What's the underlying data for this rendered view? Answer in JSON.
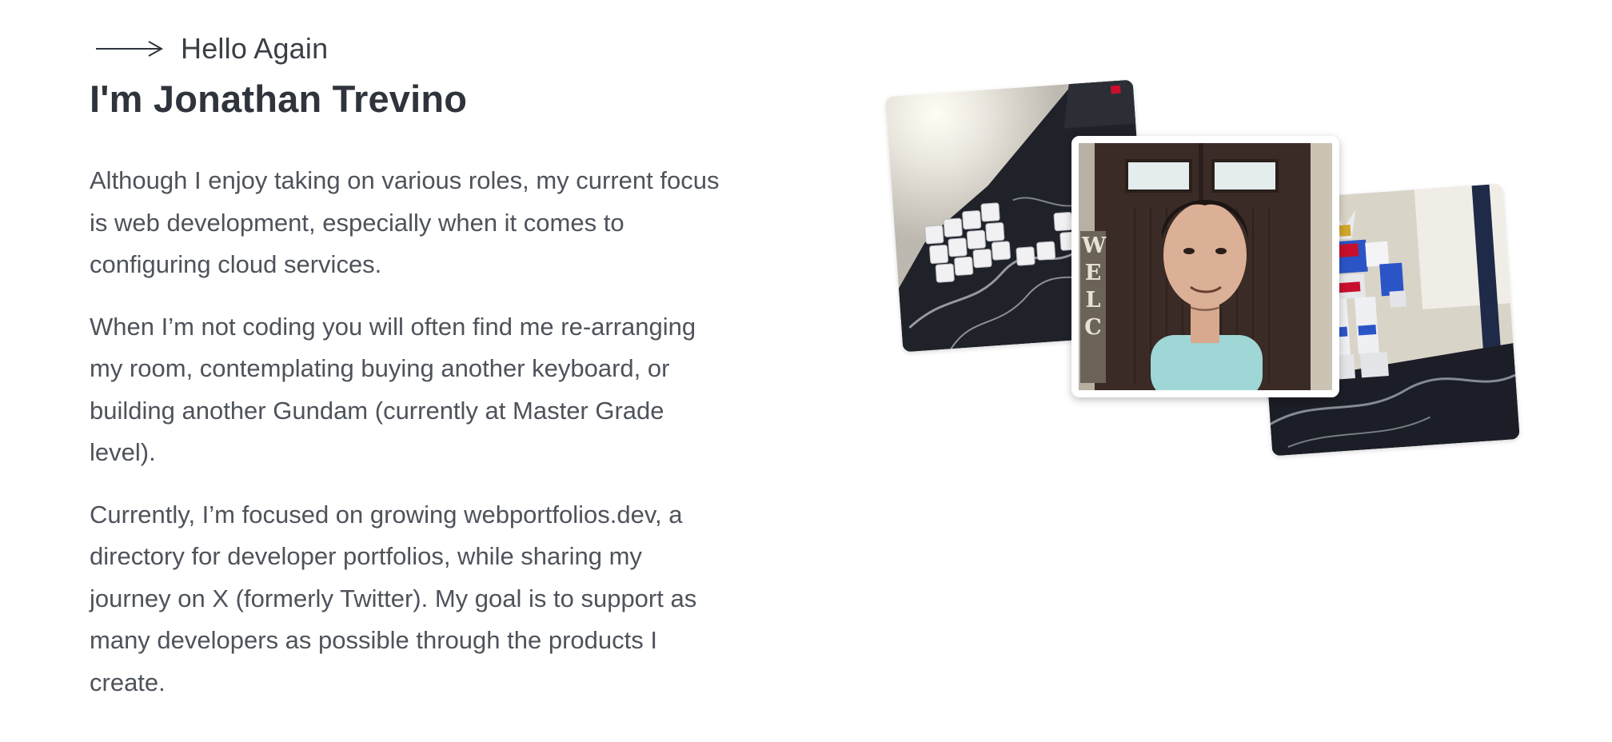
{
  "intro": {
    "eyebrow": "Hello Again",
    "title": "I'm Jonathan Trevino"
  },
  "bio": {
    "paragraphs": [
      "Although I enjoy taking on various roles, my current focus is web development, especially when it comes to configuring cloud services.",
      "When I’m not coding you will often find me re-arranging my room, contemplating buying another keyboard, or building another Gundam (currently at Master Grade level).",
      "Currently, I’m focused on growing webportfolios.dev, a directory for developer portfolios, while sharing my journey on X (formerly Twitter). My goal is to support as many developers as possible through the products I create."
    ]
  },
  "photos": {
    "portrait_sign_letters": "WELC"
  },
  "icons": {
    "eyebrow_icon": "arrow-right-icon"
  },
  "colors": {
    "heading": "#2f343c",
    "body_text": "#4e535b",
    "background": "#ffffff"
  }
}
